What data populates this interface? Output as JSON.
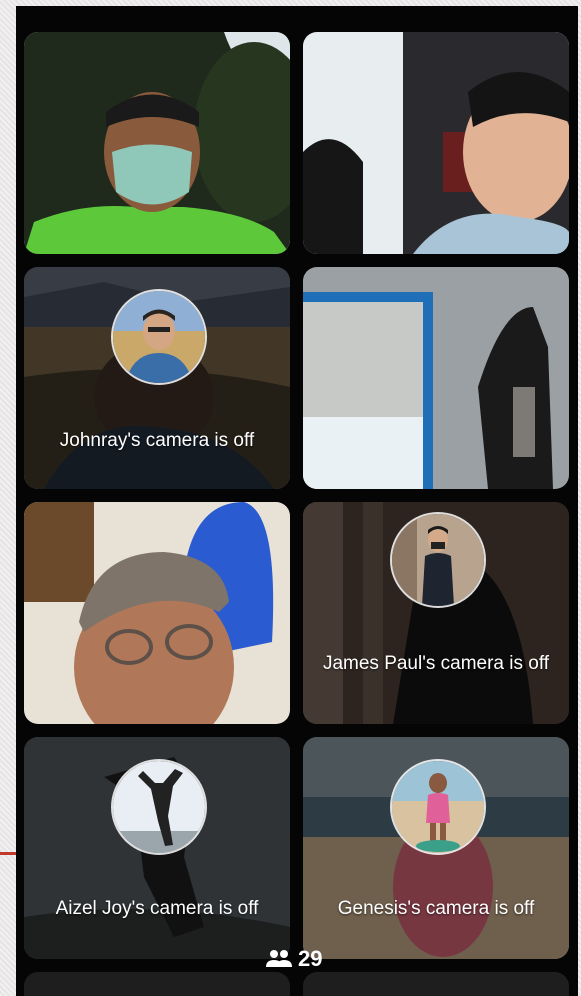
{
  "call": {
    "participant_count": "29",
    "tiles": [
      {
        "id": "tile-1",
        "video": true
      },
      {
        "id": "tile-2",
        "video": true
      },
      {
        "id": "tile-3",
        "video": false,
        "label": "Johnray's camera is off"
      },
      {
        "id": "tile-4",
        "video": true
      },
      {
        "id": "tile-5",
        "video": true
      },
      {
        "id": "tile-6",
        "video": false,
        "label": "James Paul's camera is off"
      },
      {
        "id": "tile-7",
        "video": false,
        "label": "Aizel Joy's camera is off"
      },
      {
        "id": "tile-8",
        "video": false,
        "label": "Genesis's camera is off"
      }
    ]
  },
  "icons": {
    "participants": "people-icon"
  },
  "colors": {
    "call_background": "#050505",
    "text": "#ffffff"
  }
}
